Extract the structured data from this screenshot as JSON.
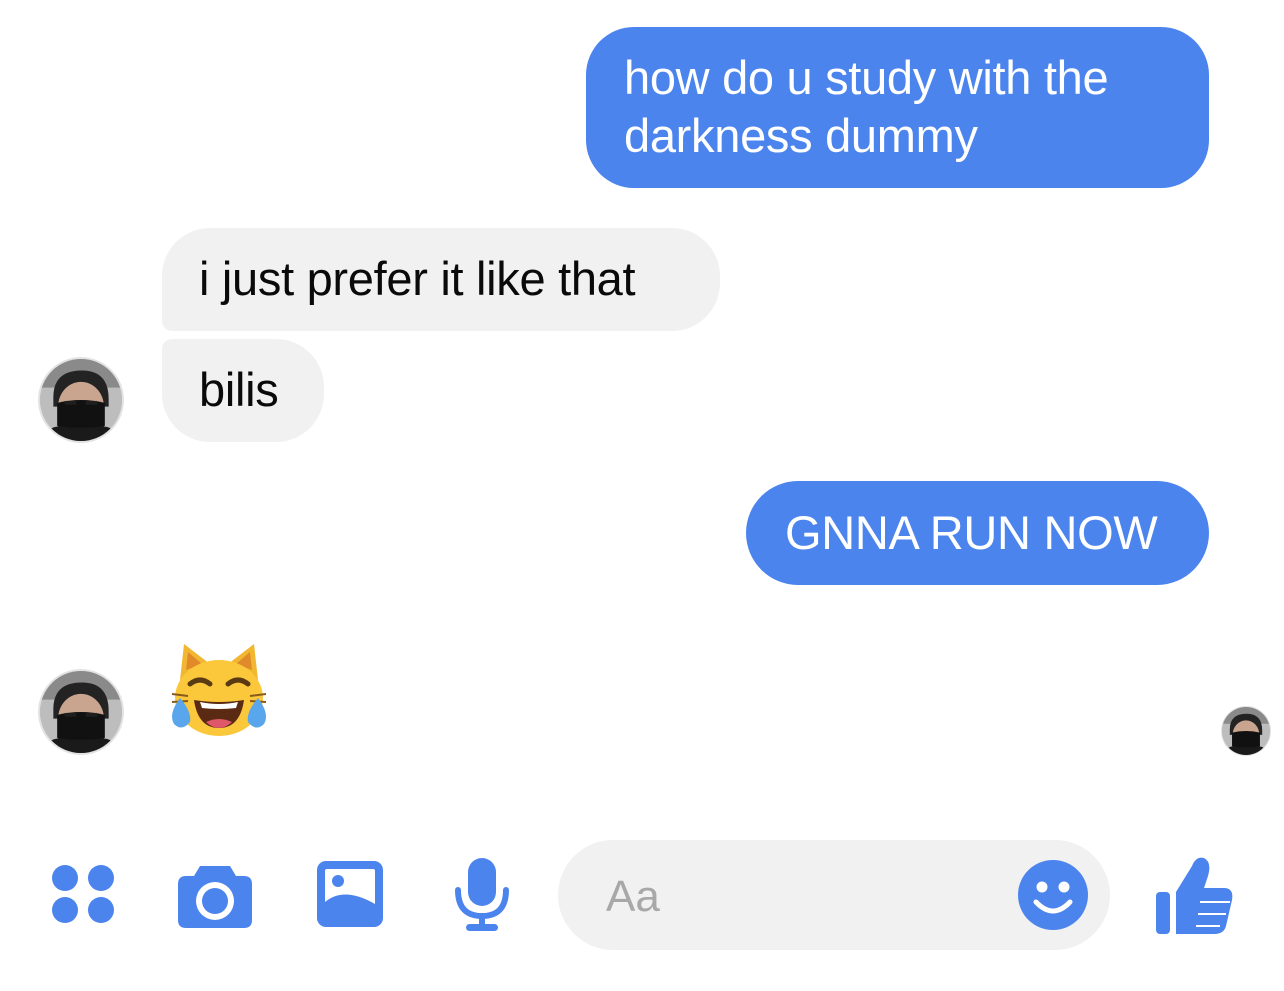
{
  "conversation": {
    "messages": [
      {
        "direction": "outgoing",
        "text": "how do u study with the darkness dummy"
      },
      {
        "direction": "incoming",
        "text": "i just prefer it like that"
      },
      {
        "direction": "incoming",
        "text": "bilis"
      },
      {
        "direction": "outgoing",
        "text": "GNNA RUN NOW"
      },
      {
        "direction": "incoming",
        "emoji": "cat-face-with-tears-of-joy"
      }
    ],
    "msg1_line1": "how do u study with the",
    "msg1_line2": "darkness dummy"
  },
  "composer": {
    "placeholder": "Aa"
  },
  "icons": {
    "more": "grid-dots-icon",
    "camera": "camera-icon",
    "gallery": "image-icon",
    "mic": "microphone-icon",
    "emoji": "smiley-icon",
    "like": "thumbs-up-icon"
  },
  "colors": {
    "accent": "#4c84ee",
    "incoming_bubble": "#f1f1f1",
    "outgoing_text": "#ffffff",
    "incoming_text": "#0a0a0a",
    "placeholder": "#a8a8a8"
  }
}
